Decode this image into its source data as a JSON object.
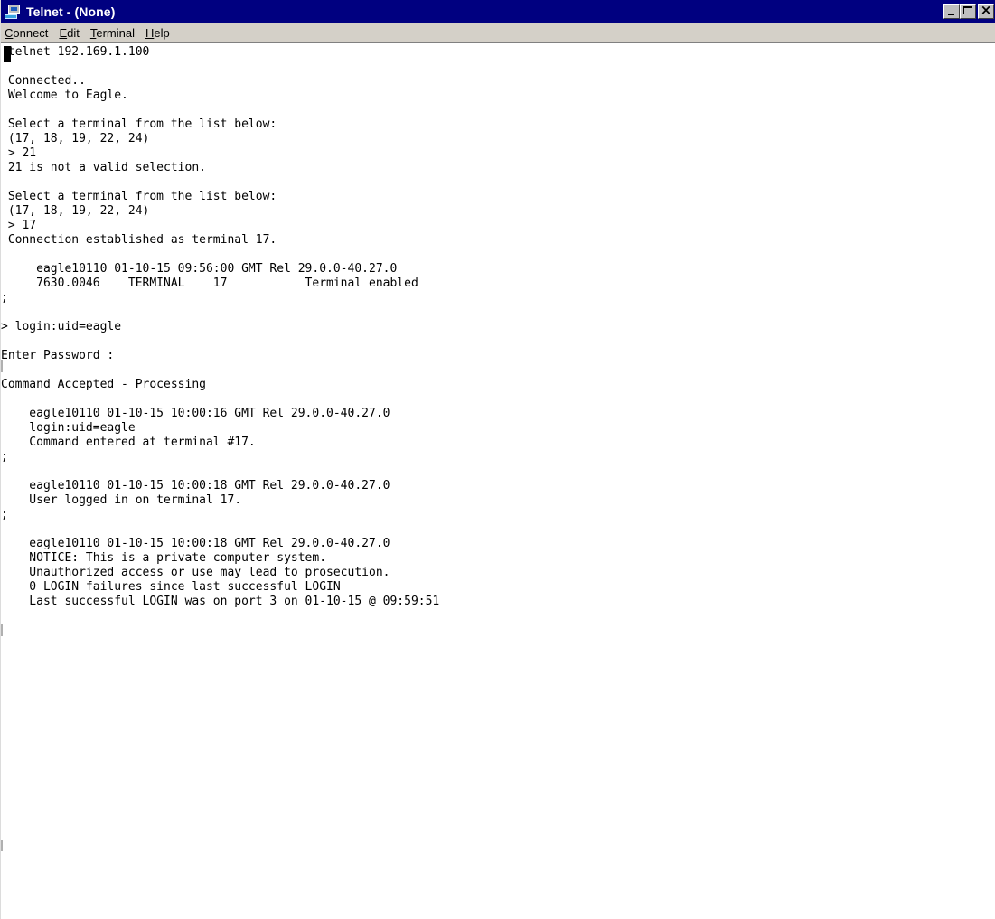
{
  "window": {
    "title": "Telnet - (None)",
    "minimize_icon": "minimize-icon",
    "maximize_icon": "maximize-icon",
    "close_glyph": "×"
  },
  "menu": {
    "items": [
      {
        "label": "Connect",
        "mnemonic": "C",
        "rest": "onnect"
      },
      {
        "label": "Edit",
        "mnemonic": "E",
        "rest": "dit"
      },
      {
        "label": "Terminal",
        "mnemonic": "T",
        "rest": "erminal"
      },
      {
        "label": "Help",
        "mnemonic": "H",
        "rest": "elp"
      }
    ]
  },
  "terminal": {
    "output": " telnet 192.169.1.100\n\n Connected..\n Welcome to Eagle.\n\n Select a terminal from the list below:\n (17, 18, 19, 22, 24)\n > 21\n 21 is not a valid selection.\n\n Select a terminal from the list below:\n (17, 18, 19, 22, 24)\n > 17\n Connection established as terminal 17.\n\n     eagle10110 01-10-15 09:56:00 GMT Rel 29.0.0-40.27.0\n     7630.0046    TERMINAL    17           Terminal enabled\n;\n\n> login:uid=eagle\n\nEnter Password :\n\nCommand Accepted - Processing\n\n    eagle10110 01-10-15 10:00:16 GMT Rel 29.0.0-40.27.0\n    login:uid=eagle\n    Command entered at terminal #17.\n;\n\n    eagle10110 01-10-15 10:00:18 GMT Rel 29.0.0-40.27.0\n    User logged in on terminal 17.\n;\n\n    eagle10110 01-10-15 10:00:18 GMT Rel 29.0.0-40.27.0\n    NOTICE: This is a private computer system.\n    Unauthorized access or use may lead to prosecution.\n    0 LOGIN failures since last successful LOGIN\n    Last successful LOGIN was on port 3 on 01-10-15 @ 09:59:51"
  },
  "colors": {
    "titlebar": "#000080",
    "menubar": "#d4d0c8",
    "terminal_bg": "#ffffff",
    "terminal_fg": "#000000"
  }
}
